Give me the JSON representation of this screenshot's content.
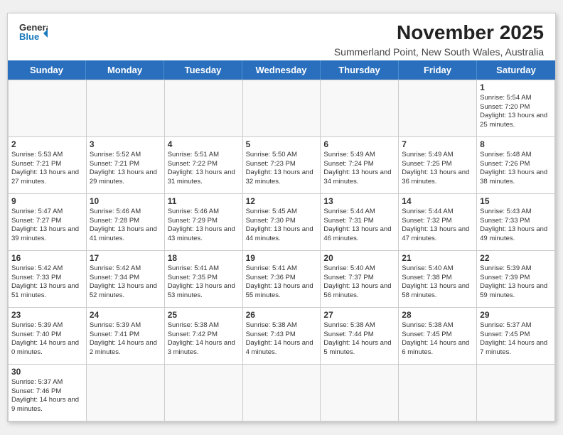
{
  "header": {
    "logo_general": "General",
    "logo_blue": "Blue",
    "month_title": "November 2025",
    "location": "Summerland Point, New South Wales, Australia"
  },
  "day_headers": [
    "Sunday",
    "Monday",
    "Tuesday",
    "Wednesday",
    "Thursday",
    "Friday",
    "Saturday"
  ],
  "cells": [
    {
      "day": "",
      "empty": true
    },
    {
      "day": "",
      "empty": true
    },
    {
      "day": "",
      "empty": true
    },
    {
      "day": "",
      "empty": true
    },
    {
      "day": "",
      "empty": true
    },
    {
      "day": "",
      "empty": true
    },
    {
      "day": "1",
      "sunrise": "Sunrise: 5:54 AM",
      "sunset": "Sunset: 7:20 PM",
      "daylight": "Daylight: 13 hours and 25 minutes."
    },
    {
      "day": "2",
      "sunrise": "Sunrise: 5:53 AM",
      "sunset": "Sunset: 7:21 PM",
      "daylight": "Daylight: 13 hours and 27 minutes."
    },
    {
      "day": "3",
      "sunrise": "Sunrise: 5:52 AM",
      "sunset": "Sunset: 7:21 PM",
      "daylight": "Daylight: 13 hours and 29 minutes."
    },
    {
      "day": "4",
      "sunrise": "Sunrise: 5:51 AM",
      "sunset": "Sunset: 7:22 PM",
      "daylight": "Daylight: 13 hours and 31 minutes."
    },
    {
      "day": "5",
      "sunrise": "Sunrise: 5:50 AM",
      "sunset": "Sunset: 7:23 PM",
      "daylight": "Daylight: 13 hours and 32 minutes."
    },
    {
      "day": "6",
      "sunrise": "Sunrise: 5:49 AM",
      "sunset": "Sunset: 7:24 PM",
      "daylight": "Daylight: 13 hours and 34 minutes."
    },
    {
      "day": "7",
      "sunrise": "Sunrise: 5:49 AM",
      "sunset": "Sunset: 7:25 PM",
      "daylight": "Daylight: 13 hours and 36 minutes."
    },
    {
      "day": "8",
      "sunrise": "Sunrise: 5:48 AM",
      "sunset": "Sunset: 7:26 PM",
      "daylight": "Daylight: 13 hours and 38 minutes."
    },
    {
      "day": "9",
      "sunrise": "Sunrise: 5:47 AM",
      "sunset": "Sunset: 7:27 PM",
      "daylight": "Daylight: 13 hours and 39 minutes."
    },
    {
      "day": "10",
      "sunrise": "Sunrise: 5:46 AM",
      "sunset": "Sunset: 7:28 PM",
      "daylight": "Daylight: 13 hours and 41 minutes."
    },
    {
      "day": "11",
      "sunrise": "Sunrise: 5:46 AM",
      "sunset": "Sunset: 7:29 PM",
      "daylight": "Daylight: 13 hours and 43 minutes."
    },
    {
      "day": "12",
      "sunrise": "Sunrise: 5:45 AM",
      "sunset": "Sunset: 7:30 PM",
      "daylight": "Daylight: 13 hours and 44 minutes."
    },
    {
      "day": "13",
      "sunrise": "Sunrise: 5:44 AM",
      "sunset": "Sunset: 7:31 PM",
      "daylight": "Daylight: 13 hours and 46 minutes."
    },
    {
      "day": "14",
      "sunrise": "Sunrise: 5:44 AM",
      "sunset": "Sunset: 7:32 PM",
      "daylight": "Daylight: 13 hours and 47 minutes."
    },
    {
      "day": "15",
      "sunrise": "Sunrise: 5:43 AM",
      "sunset": "Sunset: 7:33 PM",
      "daylight": "Daylight: 13 hours and 49 minutes."
    },
    {
      "day": "16",
      "sunrise": "Sunrise: 5:42 AM",
      "sunset": "Sunset: 7:33 PM",
      "daylight": "Daylight: 13 hours and 51 minutes."
    },
    {
      "day": "17",
      "sunrise": "Sunrise: 5:42 AM",
      "sunset": "Sunset: 7:34 PM",
      "daylight": "Daylight: 13 hours and 52 minutes."
    },
    {
      "day": "18",
      "sunrise": "Sunrise: 5:41 AM",
      "sunset": "Sunset: 7:35 PM",
      "daylight": "Daylight: 13 hours and 53 minutes."
    },
    {
      "day": "19",
      "sunrise": "Sunrise: 5:41 AM",
      "sunset": "Sunset: 7:36 PM",
      "daylight": "Daylight: 13 hours and 55 minutes."
    },
    {
      "day": "20",
      "sunrise": "Sunrise: 5:40 AM",
      "sunset": "Sunset: 7:37 PM",
      "daylight": "Daylight: 13 hours and 56 minutes."
    },
    {
      "day": "21",
      "sunrise": "Sunrise: 5:40 AM",
      "sunset": "Sunset: 7:38 PM",
      "daylight": "Daylight: 13 hours and 58 minutes."
    },
    {
      "day": "22",
      "sunrise": "Sunrise: 5:39 AM",
      "sunset": "Sunset: 7:39 PM",
      "daylight": "Daylight: 13 hours and 59 minutes."
    },
    {
      "day": "23",
      "sunrise": "Sunrise: 5:39 AM",
      "sunset": "Sunset: 7:40 PM",
      "daylight": "Daylight: 14 hours and 0 minutes."
    },
    {
      "day": "24",
      "sunrise": "Sunrise: 5:39 AM",
      "sunset": "Sunset: 7:41 PM",
      "daylight": "Daylight: 14 hours and 2 minutes."
    },
    {
      "day": "25",
      "sunrise": "Sunrise: 5:38 AM",
      "sunset": "Sunset: 7:42 PM",
      "daylight": "Daylight: 14 hours and 3 minutes."
    },
    {
      "day": "26",
      "sunrise": "Sunrise: 5:38 AM",
      "sunset": "Sunset: 7:43 PM",
      "daylight": "Daylight: 14 hours and 4 minutes."
    },
    {
      "day": "27",
      "sunrise": "Sunrise: 5:38 AM",
      "sunset": "Sunset: 7:44 PM",
      "daylight": "Daylight: 14 hours and 5 minutes."
    },
    {
      "day": "28",
      "sunrise": "Sunrise: 5:38 AM",
      "sunset": "Sunset: 7:45 PM",
      "daylight": "Daylight: 14 hours and 6 minutes."
    },
    {
      "day": "29",
      "sunrise": "Sunrise: 5:37 AM",
      "sunset": "Sunset: 7:45 PM",
      "daylight": "Daylight: 14 hours and 7 minutes."
    },
    {
      "day": "30",
      "sunrise": "Sunrise: 5:37 AM",
      "sunset": "Sunset: 7:46 PM",
      "daylight": "Daylight: 14 hours and 9 minutes."
    },
    {
      "day": "",
      "empty": true
    },
    {
      "day": "",
      "empty": true
    },
    {
      "day": "",
      "empty": true
    },
    {
      "day": "",
      "empty": true
    },
    {
      "day": "",
      "empty": true
    },
    {
      "day": "",
      "empty": true
    }
  ]
}
